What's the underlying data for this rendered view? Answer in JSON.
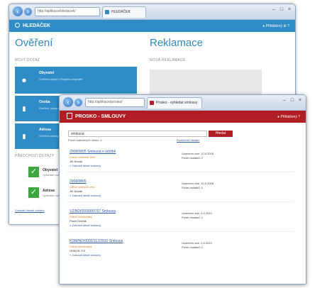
{
  "back_window": {
    "address": "http://aplikace/hledacek/",
    "tab": "HLEDÁČEK",
    "app_title": "HLEDÁČEK",
    "user": "Přihlášený",
    "left": {
      "title": "Ověření",
      "subtitle": "NOVÝ DOTAZ",
      "cards": [
        {
          "title": "Obyvatel",
          "desc": "Ověření osoby v Registru obyvatel",
          "icon": "person-icon"
        },
        {
          "title": "Osoba",
          "desc": "Ověření osoby v Registru osob",
          "icon": "card-icon"
        },
        {
          "title": "Adresa",
          "desc": "Ověření adresy v RÚIAN",
          "icon": "card-icon"
        }
      ],
      "history_label": "PŘEDCHOZÍ DOTAZY",
      "checks": [
        {
          "label": "Obyvatel",
          "desc": "Výsledek ověření"
        },
        {
          "label": "Adresa",
          "desc": "Výsledek ověření"
        }
      ],
      "history_link": "Zobrazit historii ověření"
    },
    "right": {
      "title": "Reklamace",
      "subtitle": "NOVÁ REKLAMACE"
    }
  },
  "front_window": {
    "address": "http://aplikace/prosko/",
    "tab": "Prosko - vyhledat smlouvy",
    "app_title": "PROSKO - SMLOUVY",
    "user": "Přihlášený",
    "search_value": "smlouva",
    "search_button": "Hledat",
    "filter": "Počet nalezených smluv: 4",
    "advanced": "Rozšířené hledání",
    "results": [
      {
        "title": "2008/0805 Smlouva o údržbě",
        "org": "Odbor vnitřních věcí",
        "owner": "Jiří Novák",
        "detail": "» Zobrazit detail smlouvy",
        "meta1": "Uzavřeno dne: 12.5.2008",
        "meta2": "Počet dodatků: 2"
      },
      {
        "title": "2008/0805",
        "org": "Odbor vnitřních věcí",
        "owner": "Jiří Novák",
        "detail": "» Zobrazit detail smlouvy",
        "meta1": "Uzavřeno dne: 12.5.2008",
        "meta2": "Počet dodatků: 1"
      },
      {
        "title": "VZ/ND/0000000707 Smlouva",
        "org": "Odbor informatiky",
        "owner": "Pavel Dvořák",
        "detail": "» Zobrazit detail smlouvy",
        "meta1": "Uzavřeno dne: 3.4.2010",
        "meta2": "Počet dodatků: 1"
      },
      {
        "title": "KOM/ND/0000/112/2010 Smlouva",
        "org": "Odbor informatiky",
        "owner": "ODBOR ITS",
        "detail": "» Zobrazit detail smlouvy",
        "meta1": "Uzavřeno dne: 2.6.2010",
        "meta2": "Počet dodatků: 1"
      }
    ]
  },
  "colors": {
    "blue": "#2f8cc6",
    "red": "#b01e23",
    "green": "#3ea740",
    "link": "#2a5ca8",
    "orange": "#e07a1a"
  }
}
